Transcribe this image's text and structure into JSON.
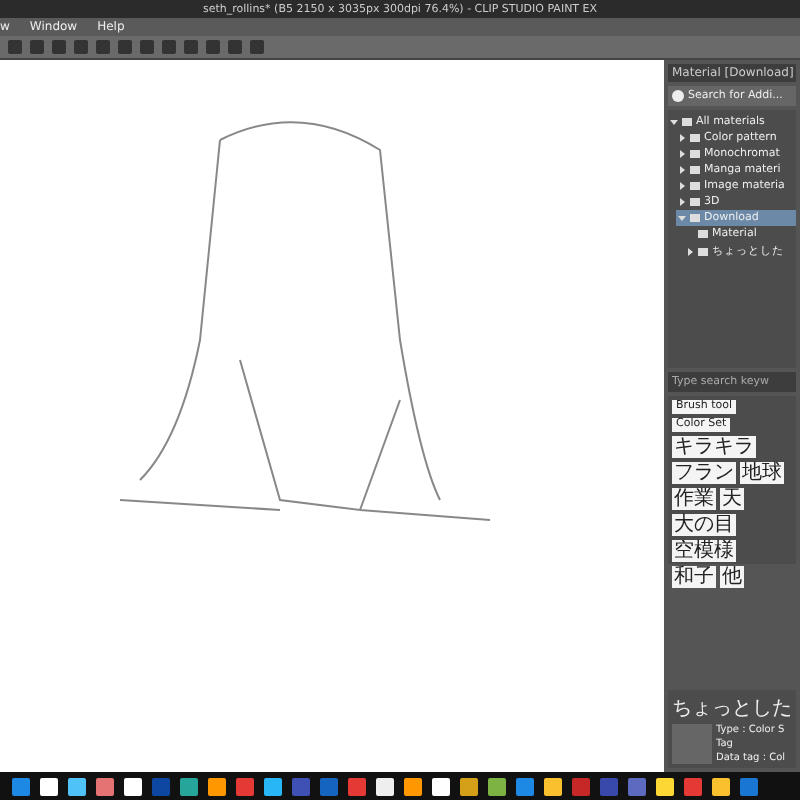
{
  "window": {
    "title": "seth_rollins* (B5 2150 x 3035px 300dpi 76.4%) - CLIP STUDIO PAINT EX"
  },
  "menu": [
    "w",
    "Window",
    "Help"
  ],
  "material_panel": {
    "tab": "Material [Download]",
    "search_button": "Search for Addi...",
    "tree": [
      {
        "label": "All materials",
        "expanded": true,
        "selected": false,
        "children": [
          {
            "label": "Color pattern",
            "expanded": false,
            "selected": false
          },
          {
            "label": "Monochromat",
            "expanded": false,
            "selected": false
          },
          {
            "label": "Manga materi",
            "expanded": false,
            "selected": false
          },
          {
            "label": "Image materia",
            "expanded": false,
            "selected": false
          },
          {
            "label": "3D",
            "expanded": false,
            "selected": false
          },
          {
            "label": "Download",
            "expanded": true,
            "selected": true,
            "children": [
              {
                "label": "Material",
                "selected": false
              },
              {
                "label": "ちょっとした",
                "expanded": false,
                "selected": false
              }
            ]
          }
        ]
      }
    ],
    "tag_search": {
      "placeholder": "Type search keyw"
    },
    "tags": [
      [
        "Brush tool"
      ],
      [
        "Color Set"
      ],
      [
        "キラキラ"
      ],
      [
        "フラン",
        "地球"
      ],
      [
        "作業",
        "天"
      ],
      [
        "大の目"
      ],
      [
        "空模様"
      ],
      [
        "和子",
        "他"
      ]
    ],
    "preview": {
      "name": "ちょっとした",
      "type": "Type : Color S",
      "tag": "Tag",
      "data_tag": "Data tag : Col"
    }
  }
}
